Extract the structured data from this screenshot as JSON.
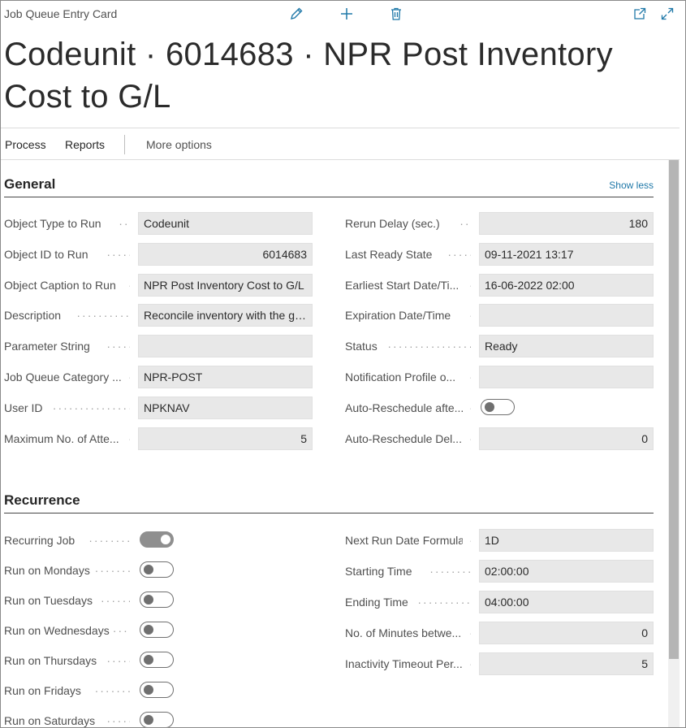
{
  "header": {
    "page_kind": "Job Queue Entry Card",
    "title": "Codeunit · 6014683 · NPR Post Inventory Cost to G/L",
    "icons": {
      "edit": "pencil-icon",
      "new": "plus-icon",
      "delete": "trash-icon",
      "open_new_window": "open-new-window-icon",
      "expand": "expand-icon"
    }
  },
  "actions": {
    "process": "Process",
    "reports": "Reports",
    "more": "More options"
  },
  "general": {
    "title": "General",
    "show_less": "Show less",
    "left": [
      {
        "label": "Object Type to Run",
        "value": "Codeunit",
        "align": "left"
      },
      {
        "label": "Object ID to Run",
        "value": "6014683",
        "align": "right"
      },
      {
        "label": "Object Caption to Run",
        "value": "NPR Post Inventory Cost to G/L",
        "align": "left"
      },
      {
        "label": "Description",
        "value": "Reconcile inventory with the ge...",
        "align": "left"
      },
      {
        "label": "Parameter String",
        "value": "",
        "align": "left"
      },
      {
        "label": "Job Queue Category ...",
        "value": "NPR-POST",
        "align": "left"
      },
      {
        "label": "User ID",
        "value": "NPKNAV",
        "align": "left"
      },
      {
        "label": "Maximum No. of Atte...",
        "value": "5",
        "align": "right"
      }
    ],
    "right": [
      {
        "label": "Rerun Delay (sec.)",
        "value": "180",
        "align": "right"
      },
      {
        "label": "Last Ready State",
        "value": "09-11-2021 13:17",
        "align": "left"
      },
      {
        "label": "Earliest Start Date/Ti...",
        "value": "16-06-2022 02:00",
        "align": "left"
      },
      {
        "label": "Expiration Date/Time",
        "value": "",
        "align": "left"
      },
      {
        "label": "Status",
        "value": "Ready",
        "align": "left"
      },
      {
        "label": "Notification Profile o...",
        "value": "",
        "align": "left"
      },
      {
        "label": "Auto-Reschedule afte...",
        "toggle": false
      },
      {
        "label": "Auto-Reschedule Del...",
        "value": "0",
        "align": "right"
      }
    ]
  },
  "recurrence": {
    "title": "Recurrence",
    "left": [
      {
        "label": "Recurring Job",
        "toggle": true
      },
      {
        "label": "Run on Mondays",
        "toggle": false
      },
      {
        "label": "Run on Tuesdays",
        "toggle": false
      },
      {
        "label": "Run on Wednesdays",
        "toggle": false
      },
      {
        "label": "Run on Thursdays",
        "toggle": false
      },
      {
        "label": "Run on Fridays",
        "toggle": false
      },
      {
        "label": "Run on Saturdays",
        "toggle": false
      }
    ],
    "right": [
      {
        "label": "Next Run Date Formula",
        "value": "1D",
        "align": "left"
      },
      {
        "label": "Starting Time",
        "value": "02:00:00",
        "align": "left"
      },
      {
        "label": "Ending Time",
        "value": "04:00:00",
        "align": "left"
      },
      {
        "label": "No. of Minutes betwe...",
        "value": "0",
        "align": "right"
      },
      {
        "label": "Inactivity Timeout Per...",
        "value": "5",
        "align": "right"
      }
    ]
  }
}
